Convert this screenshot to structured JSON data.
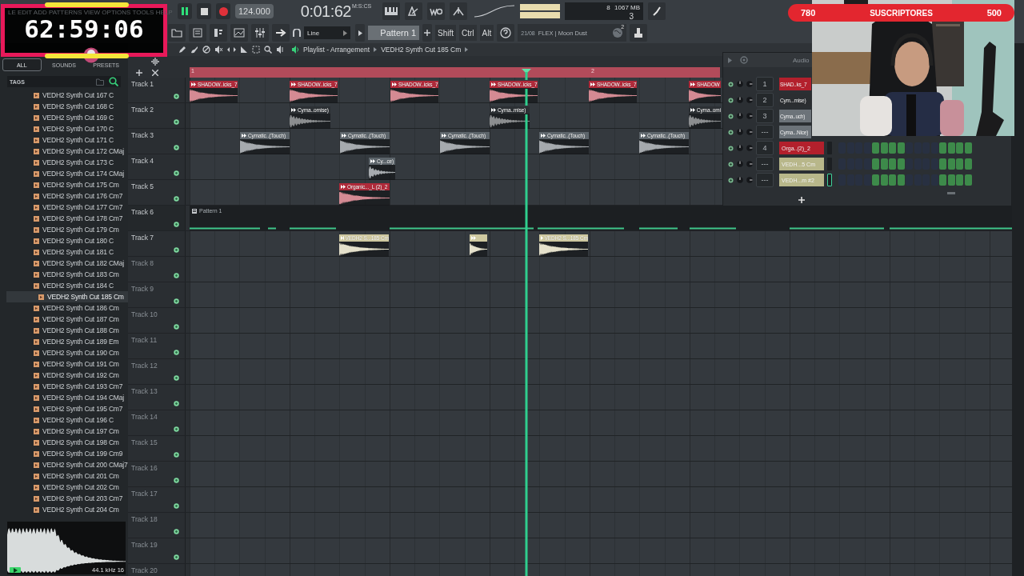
{
  "overlay_timer": {
    "menu_text": "LE EDIT ADD PATTERNS VIEW OPTIONS TOOLS HELP",
    "time": "62:59:06"
  },
  "subscriber_goal": {
    "current": "780",
    "label": "SUSCRIPTORES",
    "goal": "500"
  },
  "transport": {
    "playing": true,
    "tempo": "124.000",
    "time": "0:01:62",
    "time_format": "M:S:CS",
    "cpu": "8",
    "memory": "1067 MB",
    "polyphony": "3"
  },
  "toolbar": {
    "snap": "Line",
    "pattern": "Pattern 1",
    "modifiers": [
      "Shift",
      "Ctrl",
      "Alt"
    ],
    "hint_date": "21/08",
    "hint_text": "FLEX | Moon Dust",
    "hint_count": "2"
  },
  "browser": {
    "tabs": [
      {
        "label": "ALL",
        "selected": true
      },
      {
        "label": "SOUNDS",
        "selected": false
      },
      {
        "label": "PRESETS",
        "selected": false
      }
    ],
    "tags_label": "TAGS",
    "items": [
      {
        "name": "VEDH2 Synth Cut 167 C",
        "selected": false
      },
      {
        "name": "VEDH2 Synth Cut 168 C",
        "selected": false
      },
      {
        "name": "VEDH2 Synth Cut 169 C",
        "selected": false
      },
      {
        "name": "VEDH2 Synth Cut 170 C",
        "selected": false
      },
      {
        "name": "VEDH2 Synth Cut 171 C",
        "selected": false
      },
      {
        "name": "VEDH2 Synth Cut 172 CMaj",
        "selected": false
      },
      {
        "name": "VEDH2 Synth Cut 173 C",
        "selected": false
      },
      {
        "name": "VEDH2 Synth Cut 174 CMaj",
        "selected": false
      },
      {
        "name": "VEDH2 Synth Cut 175 Cm",
        "selected": false
      },
      {
        "name": "VEDH2 Synth Cut 176 Cm7",
        "selected": false
      },
      {
        "name": "VEDH2 Synth Cut 177 Cm7",
        "selected": false
      },
      {
        "name": "VEDH2 Synth Cut 178 Cm7",
        "selected": false
      },
      {
        "name": "VEDH2 Synth Cut 179 Cm",
        "selected": false
      },
      {
        "name": "VEDH2 Synth Cut 180 C",
        "selected": false
      },
      {
        "name": "VEDH2 Synth Cut 181 C",
        "selected": false
      },
      {
        "name": "VEDH2 Synth Cut 182 CMaj",
        "selected": false
      },
      {
        "name": "VEDH2 Synth Cut 183 Cm",
        "selected": false
      },
      {
        "name": "VEDH2 Synth Cut 184 C",
        "selected": false
      },
      {
        "name": "VEDH2 Synth Cut 185 Cm",
        "selected": true
      },
      {
        "name": "VEDH2 Synth Cut 186 Cm",
        "selected": false
      },
      {
        "name": "VEDH2 Synth Cut 187 Cm",
        "selected": false
      },
      {
        "name": "VEDH2 Synth Cut 188 Cm",
        "selected": false
      },
      {
        "name": "VEDH2 Synth Cut 189 Em",
        "selected": false
      },
      {
        "name": "VEDH2 Synth Cut 190 Cm",
        "selected": false
      },
      {
        "name": "VEDH2 Synth Cut 191 Cm",
        "selected": false
      },
      {
        "name": "VEDH2 Synth Cut 192 Cm",
        "selected": false
      },
      {
        "name": "VEDH2 Synth Cut 193 Cm7",
        "selected": false
      },
      {
        "name": "VEDH2 Synth Cut 194 CMaj",
        "selected": false
      },
      {
        "name": "VEDH2 Synth Cut 195 Cm7",
        "selected": false
      },
      {
        "name": "VEDH2 Synth Cut 196 C",
        "selected": false
      },
      {
        "name": "VEDH2 Synth Cut 197 Cm",
        "selected": false
      },
      {
        "name": "VEDH2 Synth Cut 198 Cm",
        "selected": false
      },
      {
        "name": "VEDH2 Synth Cut 199 Cm9",
        "selected": false
      },
      {
        "name": "VEDH2 Synth Cut 200 CMaj7",
        "selected": false
      },
      {
        "name": "VEDH2 Synth Cut 201 Cm",
        "selected": false
      },
      {
        "name": "VEDH2 Synth Cut 202 Cm",
        "selected": false
      },
      {
        "name": "VEDH2 Synth Cut 203 Cm7",
        "selected": false
      },
      {
        "name": "VEDH2 Synth Cut 204 Cm",
        "selected": false
      }
    ],
    "preview": {
      "sample_rate": "44.1 kHz",
      "bit_depth": "16"
    }
  },
  "playlist": {
    "title": "Playlist - Arrangement",
    "breadcrumb": "VEDH2 Synth Cut 185 Cm",
    "ruler": [
      "1",
      "2"
    ],
    "tracks": [
      {
        "name": "Track 1",
        "kind": "audio",
        "empty": false,
        "clips": [
          {
            "label": "SHADOW..icks_7",
            "color": "#b02a3a"
          },
          {
            "label": "SHADOW..icks_7",
            "color": "#b02a3a"
          },
          {
            "label": "SHADOW..icks_7",
            "color": "#b02a3a"
          },
          {
            "label": "SHADOW..icks_7",
            "color": "#b02a3a"
          },
          {
            "label": "SHADOW..icks_7",
            "color": "#b02a3a"
          },
          {
            "label": "SHADOW",
            "color": "#b02a3a"
          }
        ]
      },
      {
        "name": "Track 2",
        "kind": "audio",
        "empty": false,
        "clips": [
          {
            "label": "Cyma..omise)",
            "color": "#2c3034"
          },
          {
            "label": "Cyma..mise)",
            "color": "#2c3034"
          },
          {
            "label": "Cyma..omi",
            "color": "#2c3034"
          }
        ]
      },
      {
        "name": "Track 3",
        "kind": "audio",
        "empty": false,
        "clips": [
          {
            "label": "Cymatic..(Touch)",
            "color": "#5d656b"
          },
          {
            "label": "Cymatic..(Touch)",
            "color": "#5d656b"
          },
          {
            "label": "Cymatic..(Touch)",
            "color": "#5d656b"
          },
          {
            "label": "Cymatic..(Touch)",
            "color": "#5d656b"
          },
          {
            "label": "Cymatic..(Touch)",
            "color": "#5d656b"
          }
        ]
      },
      {
        "name": "Track 4",
        "kind": "audio",
        "empty": false,
        "clips": [
          {
            "label": "Cy...ce)",
            "color": "#5d656b"
          }
        ]
      },
      {
        "name": "Track 5",
        "kind": "audio",
        "empty": false,
        "clips": [
          {
            "label": "Organic..._L (2)_2",
            "color": "#b02a3a"
          }
        ]
      },
      {
        "name": "Track 6",
        "kind": "pattern",
        "empty": false,
        "pattern": "Pattern 1"
      },
      {
        "name": "Track 7",
        "kind": "audio",
        "empty": false,
        "clips": [
          {
            "label": "VEDH2 S...185 Cm",
            "color": "#cfc9a0"
          },
          {
            "color": "#cfc9a0"
          },
          {
            "label": "VEDH2 S...185 Cm",
            "color": "#cfc9a0"
          }
        ]
      },
      {
        "name": "Track 8",
        "kind": "audio",
        "empty": true
      },
      {
        "name": "Track 9",
        "kind": "audio",
        "empty": true
      },
      {
        "name": "Track 10",
        "kind": "audio",
        "empty": true
      },
      {
        "name": "Track 11",
        "kind": "audio",
        "empty": true
      },
      {
        "name": "Track 12",
        "kind": "audio",
        "empty": true
      },
      {
        "name": "Track 13",
        "kind": "audio",
        "empty": true
      },
      {
        "name": "Track 14",
        "kind": "audio",
        "empty": true
      },
      {
        "name": "Track 15",
        "kind": "audio",
        "empty": true
      },
      {
        "name": "Track 16",
        "kind": "audio",
        "empty": true
      },
      {
        "name": "Track 17",
        "kind": "audio",
        "empty": true
      },
      {
        "name": "Track 18",
        "kind": "audio",
        "empty": true
      },
      {
        "name": "Track 19",
        "kind": "audio",
        "empty": true
      },
      {
        "name": "Track 20",
        "kind": "audio",
        "empty": true
      }
    ]
  },
  "channel_rack": {
    "title": "Audio",
    "channels": [
      {
        "number": "1",
        "name": "SHAD..ks_7",
        "color": "#b3202c"
      },
      {
        "number": "2",
        "name": "Cym...mise)",
        "color": "#2b2e31"
      },
      {
        "number": "3",
        "name": "Cyma..uch)",
        "color": "#6c7379"
      },
      {
        "number": "---",
        "name": "Cyma...Nice)",
        "color": "#6c7379"
      },
      {
        "number": "4",
        "name": "Orga..(2)_2",
        "color": "#b3202c",
        "selected": false,
        "steps": [
          false,
          false,
          false,
          false,
          true,
          true,
          true,
          true,
          false,
          false,
          false,
          false,
          true,
          true,
          true,
          true
        ]
      },
      {
        "number": "---",
        "name": "VEDH...5 Cm",
        "color": "#b8b78a",
        "selected": false,
        "steps": [
          false,
          false,
          false,
          false,
          true,
          true,
          true,
          true,
          false,
          false,
          false,
          false,
          true,
          true,
          true,
          true
        ]
      },
      {
        "number": "---",
        "name": "VEDH...m #2",
        "color": "#b8b78a",
        "selected": true,
        "steps": [
          false,
          false,
          false,
          false,
          true,
          true,
          true,
          true,
          false,
          false,
          false,
          false,
          true,
          true,
          true,
          true
        ]
      }
    ]
  }
}
